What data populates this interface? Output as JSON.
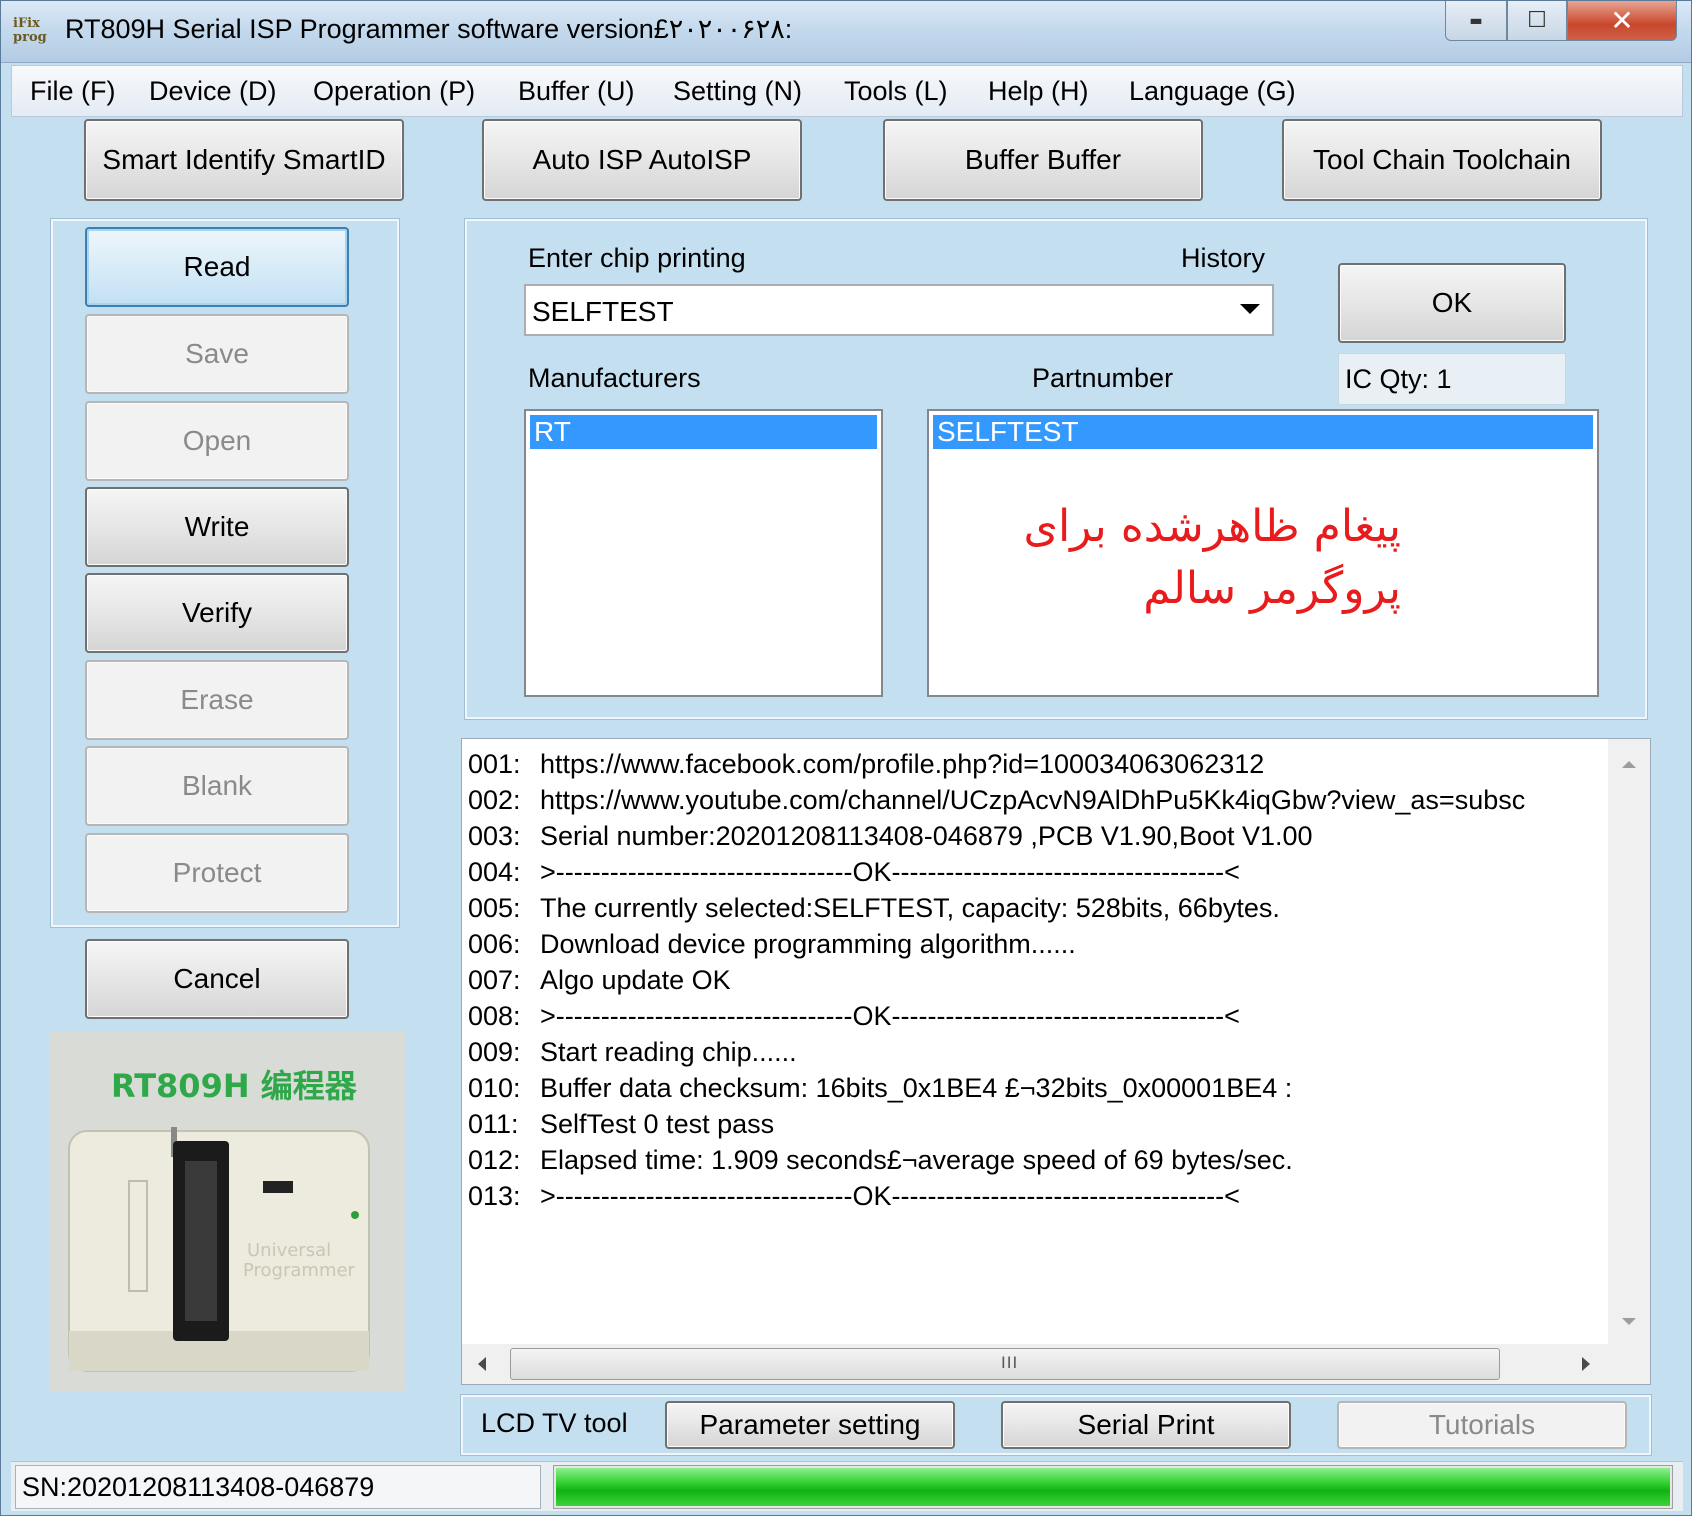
{
  "window": {
    "title": "RT809H Serial ISP Programmer software version£۲۰۲۰۰۶۲۸:",
    "logo_text": [
      "iFix",
      "prog"
    ],
    "close_glyph": "✕",
    "maximize_glyph": "☐",
    "minimize_glyph": "▬"
  },
  "menu": [
    {
      "label": "File (F)"
    },
    {
      "label": "Device (D)"
    },
    {
      "label": "Operation (P)"
    },
    {
      "label": "Buffer (U)"
    },
    {
      "label": "Setting (N)"
    },
    {
      "label": "Tools (L)"
    },
    {
      "label": "Help (H)"
    },
    {
      "label": "Language (G)"
    }
  ],
  "top_buttons": [
    {
      "label": "Smart Identify SmartID"
    },
    {
      "label": "Auto ISP AutoISP"
    },
    {
      "label": "Buffer Buffer"
    },
    {
      "label": "Tool Chain Toolchain"
    }
  ],
  "operations": [
    {
      "label": "Read",
      "enabled": true,
      "focused": true
    },
    {
      "label": "Save",
      "enabled": false
    },
    {
      "label": "Open",
      "enabled": false
    },
    {
      "label": "Write",
      "enabled": true
    },
    {
      "label": "Verify",
      "enabled": true
    },
    {
      "label": "Erase",
      "enabled": false
    },
    {
      "label": "Blank",
      "enabled": false
    },
    {
      "label": "Protect",
      "enabled": false
    }
  ],
  "cancel_label": "Cancel",
  "chip": {
    "enter_label": "Enter chip printing",
    "history_label": "History",
    "value": "SELFTEST",
    "ok_label": "OK",
    "ic_qty": "IC Qty: 1",
    "manufacturers_label": "Manufacturers",
    "partnumber_label": "Partnumber",
    "manufacturer_selected": "RT",
    "partnumber_selected": "SELFTEST"
  },
  "overlay_message": [
    "پیغام ظاهرشده برای",
    "پروگرمر سالم"
  ],
  "log": [
    {
      "num": "001:",
      "text": "https://www.facebook.com/profile.php?id=100034063062312"
    },
    {
      "num": "002:",
      "text": "https://www.youtube.com/channel/UCzpAcvN9AlDhPu5Kk4iqGbw?view_as=subsc"
    },
    {
      "num": "003:",
      "text": "Serial number:20201208113408-046879  ,PCB V1.90,Boot V1.00"
    },
    {
      "num": "004:",
      "text": ">---------------------------------OK-------------------------------------<"
    },
    {
      "num": "005:",
      "text": "The currently selected:SELFTEST, capacity: 528bits, 66bytes."
    },
    {
      "num": "006:",
      "text": "Download device programming algorithm......"
    },
    {
      "num": "007:",
      "text": "Algo update OK"
    },
    {
      "num": "008:",
      "text": ">---------------------------------OK-------------------------------------<"
    },
    {
      "num": "009:",
      "text": "Start reading chip......"
    },
    {
      "num": "010:",
      "text": "Buffer data checksum: 16bits_0x1BE4 £¬32bits_0x00001BE4 :"
    },
    {
      "num": "011:",
      "text": "SelfTest 0 test pass"
    },
    {
      "num": "012:",
      "text": "Elapsed time: 1.909 seconds£¬average speed of 69 bytes/sec."
    },
    {
      "num": "013:",
      "text": ">---------------------------------OK-------------------------------------<"
    }
  ],
  "scroll_grip": "III",
  "bottom": {
    "lcd_label": "LCD TV tool",
    "parameter_label": "Parameter setting",
    "serial_print_label": "Serial Print",
    "tutorials_label": "Tutorials"
  },
  "status": {
    "sn": "SN:20201208113408-046879",
    "progress": 1.0
  },
  "product": {
    "caption": "RT809H 编程器",
    "device_text": [
      "Universal",
      "Programmer"
    ]
  },
  "colors": {
    "window_bg": "#c4dff0",
    "selection": "#3399ff",
    "message": "#e81c1c",
    "progress": "#12b212",
    "caption": "#2fa84a"
  }
}
